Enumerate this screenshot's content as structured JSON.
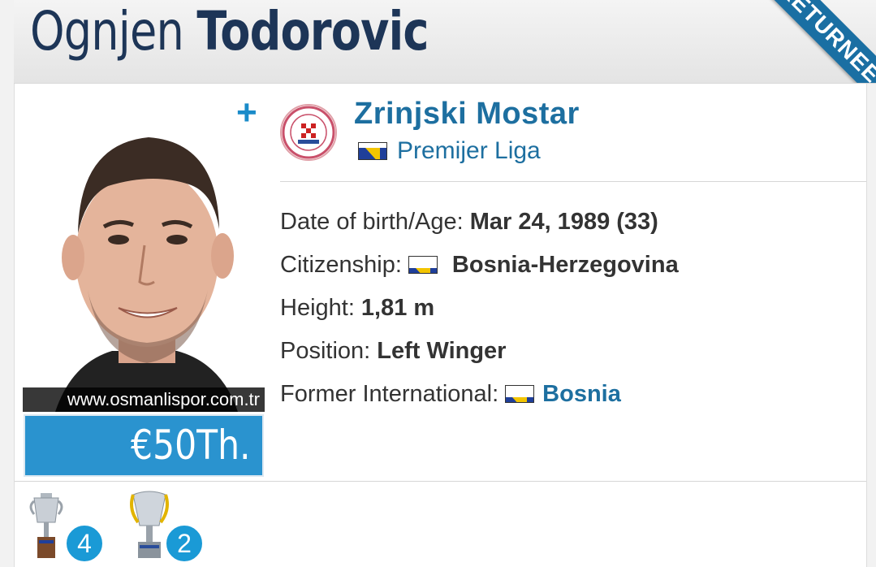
{
  "header": {
    "first_name": "Ognjen",
    "last_name": "Todorovic",
    "ribbon": "RETURNEE"
  },
  "photo": {
    "caption": "www.osmanlispor.com.tr"
  },
  "market_value": "€50Th.",
  "club": {
    "name": "Zrinjski Mostar",
    "league": "Premijer Liga"
  },
  "info": {
    "dob_label": "Date of birth/Age:",
    "dob_value": "Mar 24, 1989 (33)",
    "citizenship_label": "Citizenship:",
    "citizenship_value": "Bosnia-Herzegovina",
    "height_label": "Height:",
    "height_value": "1,81 m",
    "position_label": "Position:",
    "position_value": "Left Winger",
    "former_int_label": "Former International:",
    "former_int_value": "Bosnia"
  },
  "trophies": [
    {
      "count": "4",
      "icon": "championship-trophy-icon"
    },
    {
      "count": "2",
      "icon": "cup-trophy-icon"
    }
  ],
  "colors": {
    "accent": "#1a8bc9",
    "link": "#1d6fa0",
    "name": "#1d3557",
    "value_box": "#2a93cf"
  }
}
